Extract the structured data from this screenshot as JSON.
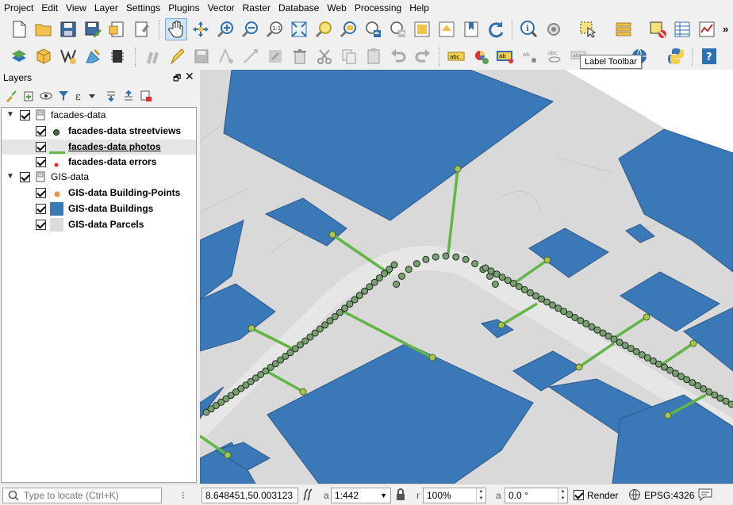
{
  "menu": [
    "Project",
    "Edit",
    "View",
    "Layer",
    "Settings",
    "Plugins",
    "Vector",
    "Raster",
    "Database",
    "Web",
    "Processing",
    "Help"
  ],
  "toolbar": {
    "overflow": "»"
  },
  "tooltip": "Label Toolbar",
  "layers_panel": {
    "title": "Layers",
    "groups": [
      {
        "name": "facades-data",
        "layers": [
          {
            "name": "facades-data streetviews",
            "symbol": "point-dark",
            "selected": false
          },
          {
            "name": "facades-data photos",
            "symbol": "line-green",
            "selected": true
          },
          {
            "name": "facades-data errors",
            "symbol": "point-red",
            "selected": false
          }
        ]
      },
      {
        "name": "GIS-data",
        "layers": [
          {
            "name": "GIS-data Building-Points",
            "symbol": "point-orange",
            "selected": false
          },
          {
            "name": "GIS-data Buildings",
            "symbol": "fill-blue",
            "selected": false
          },
          {
            "name": "GIS-data Parcels",
            "symbol": "fill-gray",
            "selected": false
          }
        ]
      }
    ]
  },
  "colors": {
    "building": "#3a78b8",
    "parcel": "#d9d9d9",
    "photo_line": "#62b547",
    "streetview": "#7a9f72",
    "building_point": "#a6c651"
  },
  "status": {
    "locator_placeholder": "Type to locate (Ctrl+K)",
    "coordinate": "8.648451,50.003123",
    "scale_label": "a",
    "scale": "1:442",
    "magnifier_label": "r",
    "magnifier": "100%",
    "rotation_label": "a",
    "rotation": "0.0 °",
    "render_label": "Render",
    "crs": "EPSG:4326"
  }
}
